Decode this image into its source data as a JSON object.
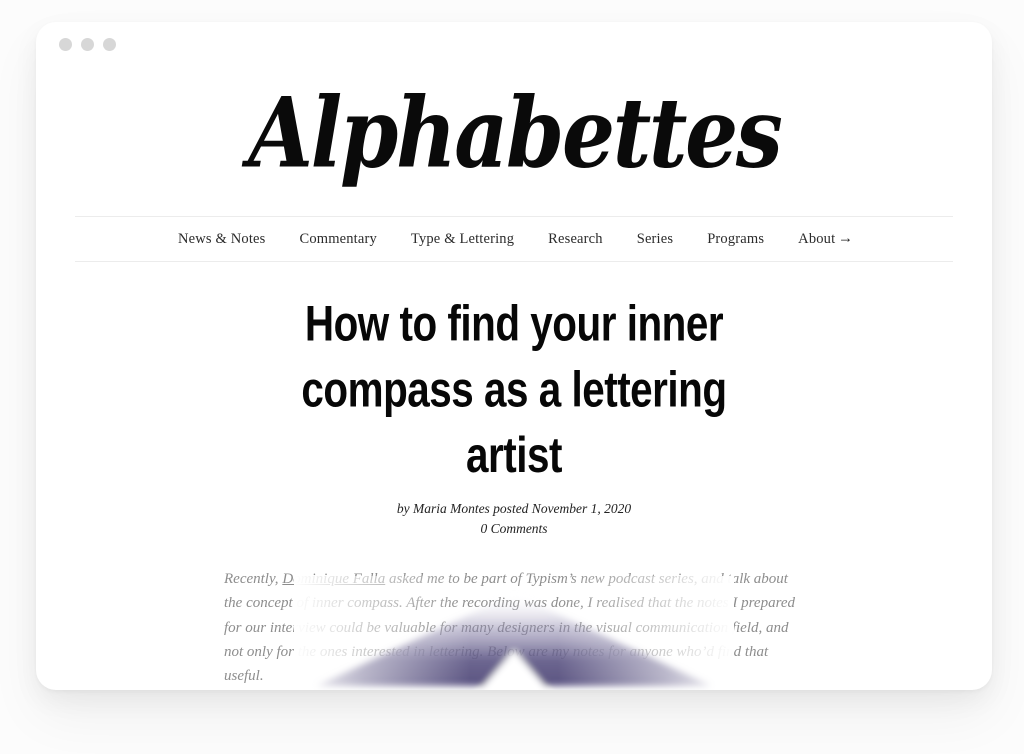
{
  "window": {
    "dots": [
      "window-dot-red",
      "window-dot-yellow",
      "window-dot-green"
    ]
  },
  "site": {
    "logo_text": "Alphabettes",
    "nav": {
      "items": [
        {
          "label": "News & Notes"
        },
        {
          "label": "Commentary"
        },
        {
          "label": "Type & Lettering"
        },
        {
          "label": "Research"
        },
        {
          "label": "Series"
        },
        {
          "label": "Programs"
        },
        {
          "label": "About"
        }
      ],
      "more_arrow": "→"
    }
  },
  "article": {
    "headline": "How to find your inner compass as a lettering artist",
    "byline": "by Maria Montes posted November 1, 2020",
    "comments": "0 Comments",
    "intro": {
      "before_link": "Recently, ",
      "link_text": "Dominique Falla",
      "after_link": " asked me to be part of Typism’s new podcast series, and talk about the concept of inner compass. After the recording was done, I realised that the notes I prepared for our interview could be valuable for many designers in the visual communication field, and not only for the ones interested in lettering. Below are my notes for anyone who’d find that useful."
    }
  },
  "colors": {
    "page_background": "#fcfcfc",
    "card_background": "#ffffff",
    "window_dot": "#d7d7d7",
    "nav_rule": "#ececec",
    "text_dark": "#070707",
    "text_muted": "#8d8d8d",
    "accent_purple": "#6b6490"
  }
}
